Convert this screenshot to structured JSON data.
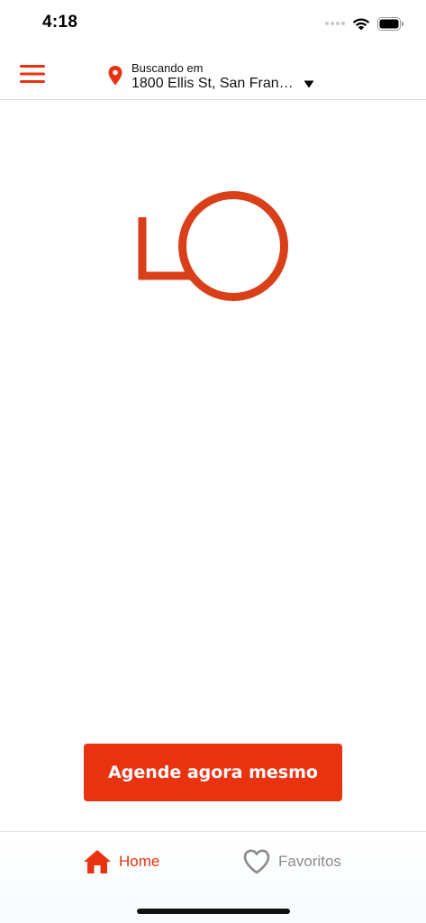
{
  "status_bar": {
    "time": "4:18"
  },
  "header": {
    "menu_icon": "hamburger-menu-icon",
    "location_icon": "map-pin-icon",
    "location_caption": "Buscando em",
    "location_address": "1800 Ellis St, San Franc...",
    "dropdown_icon": "caret-down-icon"
  },
  "logo": {
    "icon": "brand-logo-icon"
  },
  "cta": {
    "label": "Agende agora mesmo"
  },
  "tabs": [
    {
      "label": "Home",
      "icon": "home-icon",
      "active": true
    },
    {
      "label": "Favoritos",
      "icon": "heart-icon",
      "active": false
    }
  ],
  "colors": {
    "accent": "#e93210",
    "logo": "#d9401a",
    "inactive": "#8a8a8a",
    "text": "#111111"
  }
}
